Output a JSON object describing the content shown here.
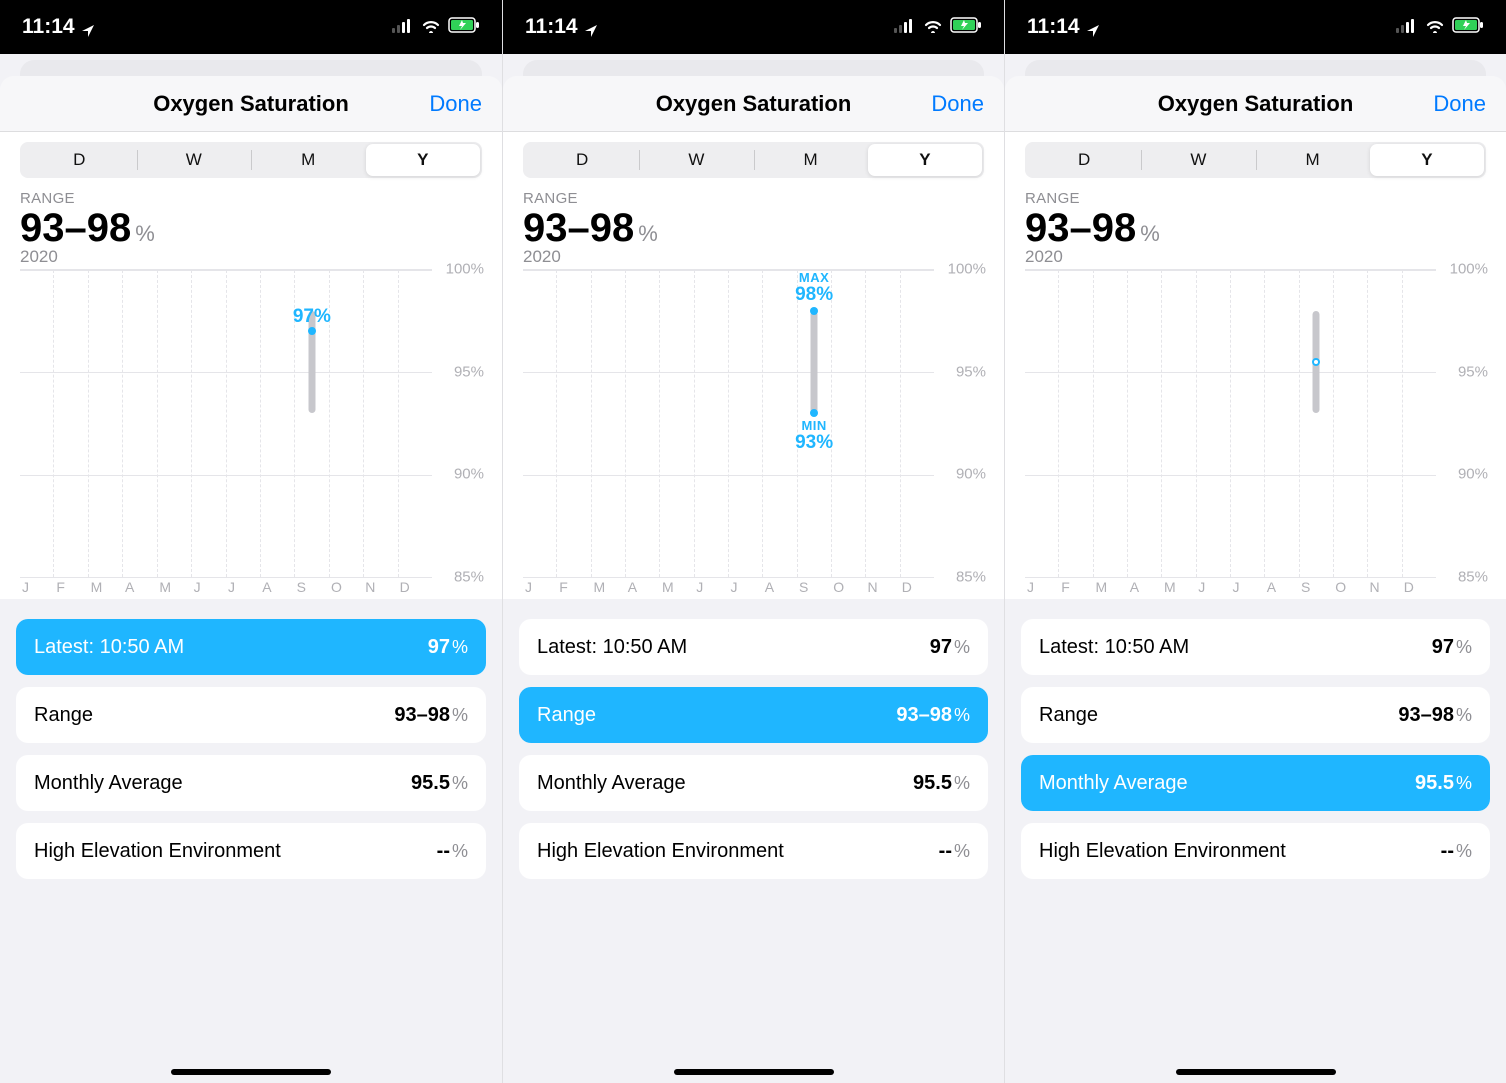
{
  "status": {
    "time": "11:14"
  },
  "nav": {
    "title": "Oxygen Saturation",
    "done": "Done"
  },
  "segments": [
    "D",
    "W",
    "M",
    "Y"
  ],
  "selected_segment": "Y",
  "range": {
    "label": "RANGE",
    "value": "93–98",
    "unit": "%",
    "year": "2020"
  },
  "chart_data": {
    "type": "bar",
    "categories": [
      "J",
      "F",
      "M",
      "A",
      "M",
      "J",
      "J",
      "A",
      "S",
      "O",
      "N",
      "D"
    ],
    "series": [
      {
        "name": "Oxygen Saturation Range",
        "min": [
          null,
          null,
          null,
          null,
          null,
          null,
          null,
          null,
          93,
          null,
          null,
          null
        ],
        "max": [
          null,
          null,
          null,
          null,
          null,
          null,
          null,
          null,
          98,
          null,
          null,
          null
        ],
        "latest": [
          null,
          null,
          null,
          null,
          null,
          null,
          null,
          null,
          97,
          null,
          null,
          null
        ],
        "avg": [
          null,
          null,
          null,
          null,
          null,
          null,
          null,
          null,
          95.5,
          null,
          null,
          null
        ]
      }
    ],
    "ylabel": "%",
    "ylim": [
      85,
      100
    ],
    "yticks": [
      85,
      90,
      95,
      100
    ]
  },
  "annotations": {
    "latest_pct": "97%",
    "max_label": "MAX",
    "max_pct": "98%",
    "min_label": "MIN",
    "min_pct": "93%"
  },
  "cards": {
    "latest": {
      "label": "Latest: 10:50 AM",
      "value": "97",
      "unit": "%"
    },
    "range": {
      "label": "Range",
      "value": "93–98",
      "unit": "%"
    },
    "avg": {
      "label": "Monthly Average",
      "value": "95.5",
      "unit": "%"
    },
    "elev": {
      "label": "High Elevation Environment",
      "value": "--",
      "unit": "%"
    }
  },
  "screens": [
    {
      "selected_card": "latest",
      "mode": "latest"
    },
    {
      "selected_card": "range",
      "mode": "range"
    },
    {
      "selected_card": "avg",
      "mode": "avg"
    }
  ]
}
